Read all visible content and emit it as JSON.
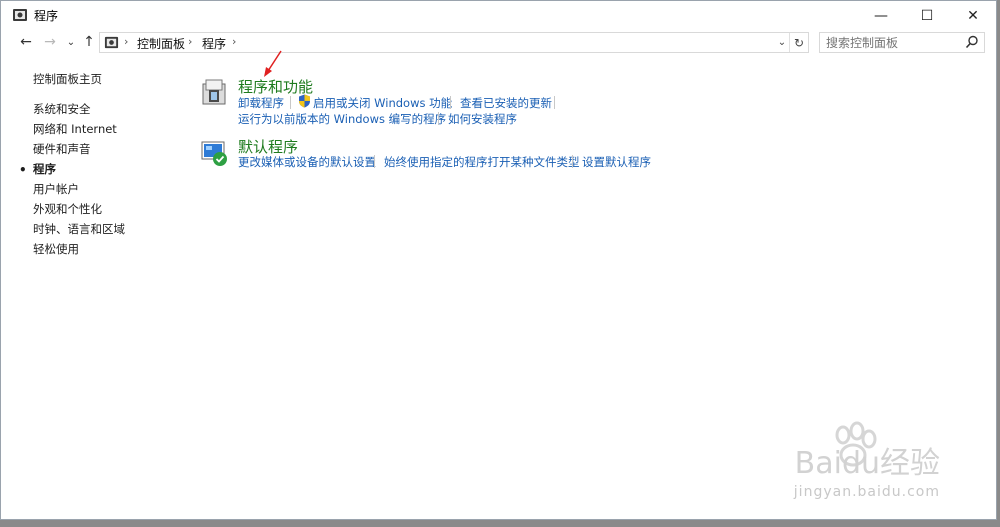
{
  "window": {
    "title": "程序",
    "minimize_symbol": "—",
    "maximize_symbol": "☐",
    "close_symbol": "✕"
  },
  "nav": {
    "back_symbol": "←",
    "forward_symbol": "→",
    "dropdown_symbol": "⌄",
    "up_symbol": "↑",
    "breadcrumbs": [
      "控制面板",
      "程序"
    ],
    "separator": "›",
    "address_dropdown_symbol": "⌄",
    "refresh_symbol": "↻"
  },
  "search": {
    "placeholder": "搜索控制面板"
  },
  "sidebar": {
    "home_label": "控制面板主页",
    "items": [
      {
        "label": "系统和安全",
        "current": false
      },
      {
        "label": "网络和 Internet",
        "current": false
      },
      {
        "label": "硬件和声音",
        "current": false
      },
      {
        "label": "程序",
        "current": true
      },
      {
        "label": "用户帐户",
        "current": false
      },
      {
        "label": "外观和个性化",
        "current": false
      },
      {
        "label": "时钟、语言和区域",
        "current": false
      },
      {
        "label": "轻松使用",
        "current": false
      }
    ],
    "bullet": "•"
  },
  "sections": [
    {
      "title": "程序和功能",
      "icon": "programs-features-icon",
      "links_row1": [
        "卸载程序",
        "启用或关闭 Windows 功能",
        "查看已安装的更新"
      ],
      "links_row2": [
        "运行为以前版本的 Windows 编写的程序",
        "如何安装程序"
      ]
    },
    {
      "title": "默认程序",
      "icon": "default-programs-icon",
      "links_row1": [
        "更改媒体或设备的默认设置",
        "始终使用指定的程序打开某种文件类型",
        "设置默认程序"
      ]
    }
  ],
  "colors": {
    "section_title": "#1e7b1e",
    "link": "#1a5fb4",
    "annotation_arrow": "#e02020"
  },
  "watermark": {
    "brand": "Baidu经验",
    "url": "jingyan.baidu.com"
  }
}
